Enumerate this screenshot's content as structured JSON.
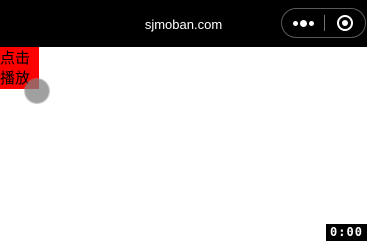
{
  "title_bar": {
    "title": "sjmoban.com",
    "background_color": "#000000",
    "menu_button_icon": "more-dots-icon",
    "close_button_icon": "mini-program-close-icon"
  },
  "main": {
    "play_button_label": "点击播放",
    "play_button_color": "#ff0000",
    "touch_indicator_icon": "touch-indicator-icon"
  },
  "timer": {
    "value": "0:00"
  }
}
